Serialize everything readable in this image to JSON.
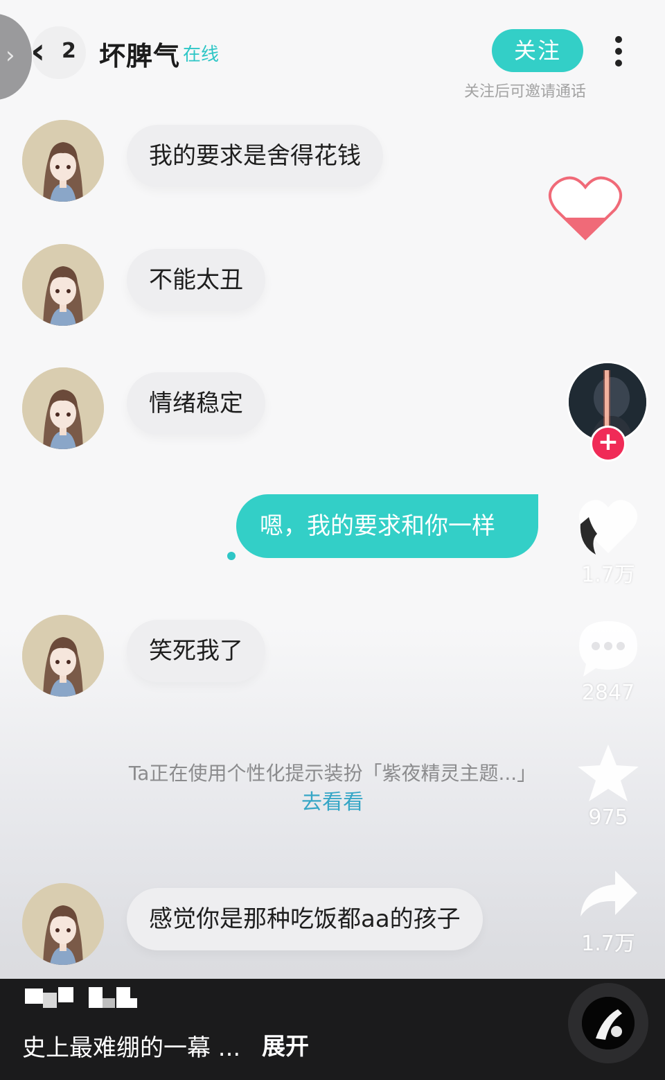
{
  "header": {
    "side_tab_icon": "chevron-right-icon",
    "back_icon": "chevron-left-icon",
    "unread_count": "2",
    "name": "坏脾气",
    "status": "在线",
    "follow_label": "关注",
    "follow_hint": "关注后可邀请通话",
    "more_icon": "more-vertical-icon"
  },
  "messages": [
    {
      "from": "other",
      "text": "我的要求是舍得花钱"
    },
    {
      "from": "other",
      "text": "不能太丑"
    },
    {
      "from": "other",
      "text": "情绪稳定"
    },
    {
      "from": "me",
      "text": "嗯，我的要求和你一样"
    },
    {
      "from": "other",
      "text": "笑死我了"
    },
    {
      "from": "other",
      "text": "感觉你是那种吃饭都aa的孩子"
    }
  ],
  "theme_tip": {
    "text": "Ta正在使用个性化提示装扮「紫夜精灵主题...」",
    "link": "去看看"
  },
  "right_rail": {
    "likes": "1.7万",
    "comments": "2847",
    "favorites": "975",
    "shares": "1.7万",
    "icons": [
      "heart-icon",
      "comment-icon",
      "star-icon",
      "share-icon"
    ]
  },
  "bottom": {
    "caption": "史上最难绷的一幕 ...",
    "expand_label": "展开"
  },
  "colors": {
    "accent": "#33cfc7",
    "plus_red": "#f02b57",
    "heart_red": "#f06a78"
  }
}
